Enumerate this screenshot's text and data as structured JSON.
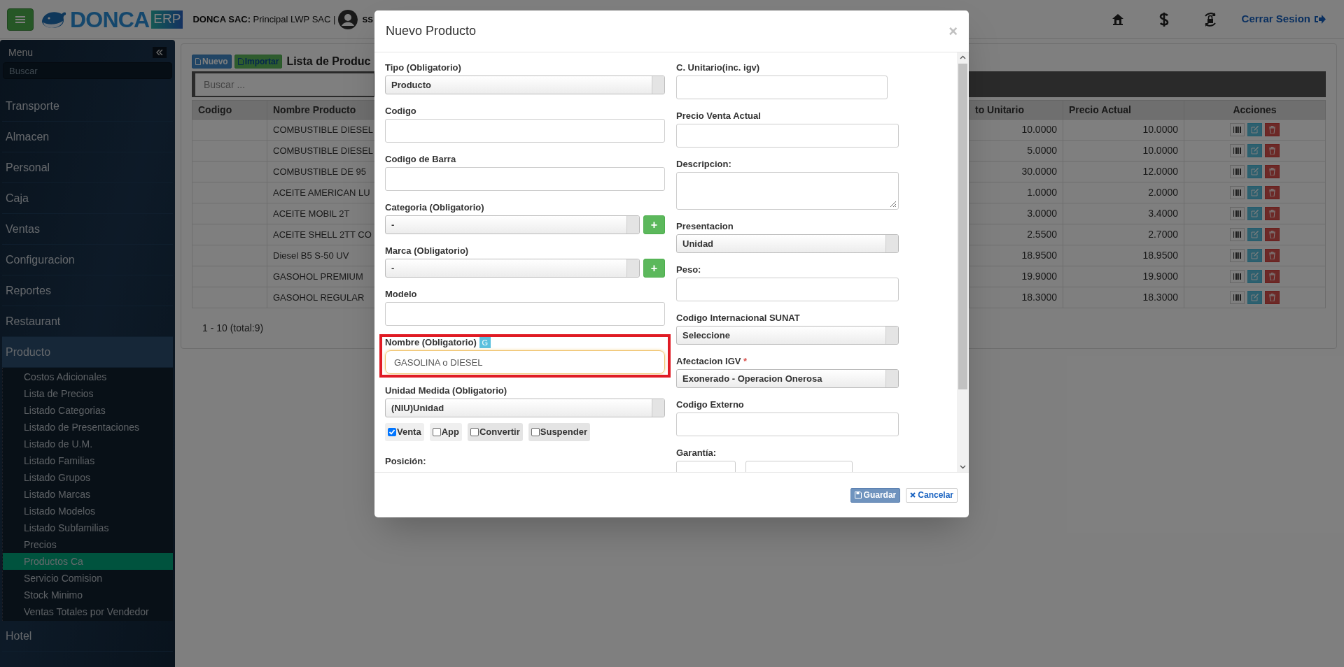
{
  "header": {
    "logo_text": "DONCA",
    "logo_badge": "ERP",
    "company_label": "DONCA SAC:",
    "company": "Principal LWP SAC |",
    "user": "ss",
    "logout": "Cerrar Sesion"
  },
  "sidebar": {
    "title": "Menu",
    "search_placeholder": "Buscar",
    "items": [
      {
        "label": "Transporte",
        "expanded": false
      },
      {
        "label": "Almacen",
        "expanded": false
      },
      {
        "label": "Personal",
        "expanded": false
      },
      {
        "label": "Caja",
        "expanded": false
      },
      {
        "label": "Ventas",
        "expanded": false
      },
      {
        "label": "Configuracion",
        "expanded": false
      },
      {
        "label": "Reportes",
        "expanded": false
      },
      {
        "label": "Restaurant",
        "expanded": false
      },
      {
        "label": "Producto",
        "expanded": true,
        "children": [
          {
            "label": "Costos Adicionales",
            "selected": false
          },
          {
            "label": "Lista de Precios",
            "selected": false
          },
          {
            "label": "Listado Categorias",
            "selected": false
          },
          {
            "label": "Listado de Presentaciones",
            "selected": false
          },
          {
            "label": "Listado de U.M.",
            "selected": false
          },
          {
            "label": "Listado Familias",
            "selected": false
          },
          {
            "label": "Listado Grupos",
            "selected": false
          },
          {
            "label": "Listado Marcas",
            "selected": false
          },
          {
            "label": "Listado Modelos",
            "selected": false
          },
          {
            "label": "Listado Subfamilias",
            "selected": false
          },
          {
            "label": "Precios",
            "selected": false
          },
          {
            "label": "Productos Ca",
            "selected": true
          },
          {
            "label": "Servicio Comision",
            "selected": false
          },
          {
            "label": "Stock Minimo",
            "selected": false
          },
          {
            "label": "Ventas Totales por Vendedor",
            "selected": false
          }
        ]
      },
      {
        "label": "Hotel",
        "expanded": false
      }
    ]
  },
  "content": {
    "buttons": [
      {
        "label": "Nuevo",
        "kind": "primary"
      },
      {
        "label": "Importar",
        "kind": "success"
      }
    ],
    "title": "Lista de Produc",
    "search_placeholder": "Buscar ...",
    "table": {
      "columns": [
        "Codigo",
        "Nombre Producto",
        "to Unitario",
        "Precio Actual",
        "Acciones"
      ],
      "rows": [
        {
          "name": "COMBUSTIBLE DIESEL",
          "unit_cost": "10.0000",
          "price": "10.0000"
        },
        {
          "name": "COMBUSTIBLE DIESEL",
          "unit_cost": "5.0000",
          "price": "10.0000"
        },
        {
          "name": "COMBUSTIBLE DE 95",
          "unit_cost": "30.0000",
          "price": "12.0000"
        },
        {
          "name": "ACEITE AMERICAN LU",
          "unit_cost": "1.0000",
          "price": "2.0000"
        },
        {
          "name": "ACEITE MOBIL 2T",
          "unit_cost": "3.0000",
          "price": "3.4000"
        },
        {
          "name": "ACEITE SHELL 2TT CO",
          "unit_cost": "2.5500",
          "price": "2.7000"
        },
        {
          "name": "Diesel B5 S-50 UV",
          "unit_cost": "18.9500",
          "price": "18.9500"
        },
        {
          "name": "GASOHOL PREMIUM",
          "unit_cost": "19.9000",
          "price": "19.9000"
        },
        {
          "name": "GASOHOL REGULAR",
          "unit_cost": "18.3000",
          "price": "18.3000"
        }
      ]
    },
    "pagination": "1 - 10 (total:9)"
  },
  "modal": {
    "title": "Nuevo Producto",
    "close": "×",
    "left_fields": [
      {
        "kind": "select",
        "label": "Tipo (Obligatorio)",
        "value": "Producto",
        "highlighted": false
      },
      {
        "kind": "input",
        "label": "Codigo",
        "highlighted": false
      },
      {
        "kind": "input",
        "label": "Codigo de Barra",
        "highlighted": false
      },
      {
        "kind": "select_add",
        "label": "Categoria (Obligatorio)",
        "value": "-",
        "add": "+",
        "highlighted": false
      },
      {
        "kind": "select_add",
        "label": "Marca (Obligatorio)",
        "value": "-",
        "add": "+",
        "highlighted": false
      },
      {
        "kind": "input",
        "label": "Modelo",
        "highlighted": false
      },
      {
        "kind": "input",
        "label": "Nombre (Obligatorio)",
        "badge": "G",
        "value": "GASOLINA o DIESEL",
        "highlighted": true
      },
      {
        "kind": "select",
        "label": "Unidad Medida (Obligatorio)",
        "value": "(NIU)Unidad",
        "highlighted": false
      }
    ],
    "checkboxes": [
      {
        "label": "Venta",
        "checked": true
      },
      {
        "label": "App",
        "checked": false
      },
      {
        "label": "Convertir",
        "checked": false
      },
      {
        "label": "Suspender",
        "checked": false
      }
    ],
    "left_last_label": "Posición:",
    "right_fields": [
      {
        "kind": "input_short",
        "label": "C. Unitario(inc. igv)"
      },
      {
        "kind": "input",
        "label": "Precio Venta Actual"
      },
      {
        "kind": "textarea",
        "label": "Descripcion:"
      },
      {
        "kind": "select",
        "label": "Presentacion",
        "value": "Unidad"
      },
      {
        "kind": "input",
        "label": "Peso:"
      },
      {
        "kind": "select",
        "label": "Codigo Internacional SUNAT",
        "value": "Seleccione"
      },
      {
        "kind": "select",
        "label": "Afectacion IGV",
        "required_mark": "*",
        "value": "Exonerado - Operacion Onerosa"
      },
      {
        "kind": "input",
        "label": "Codigo Externo"
      },
      {
        "kind": "double_input",
        "label": "Garantía:"
      }
    ],
    "buttons": [
      {
        "label": "Guardar",
        "kind": "primary"
      },
      {
        "label": "Cancelar",
        "kind": "default"
      }
    ]
  }
}
